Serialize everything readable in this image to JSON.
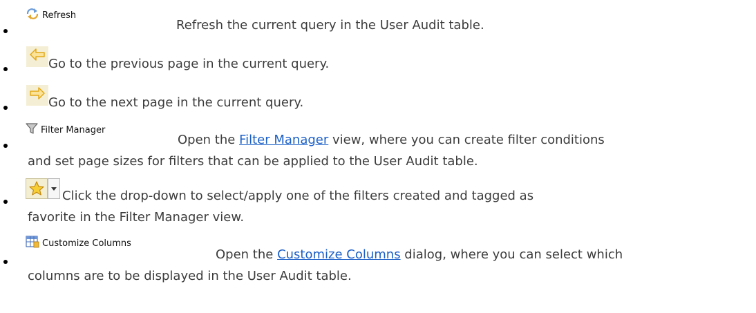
{
  "items": [
    {
      "button_label": "Refresh",
      "icon": "refresh-icon",
      "description": "Refresh the current query in the User Audit table."
    },
    {
      "icon": "previous-page-arrow-icon",
      "description": "Go to the previous page in the current query."
    },
    {
      "icon": "next-page-arrow-icon",
      "description": "Go to the next page in the current query."
    },
    {
      "button_label": "Filter Manager",
      "icon": "filter-funnel-icon",
      "text_before": "Open the ",
      "link": "Filter Manager",
      "text_after": " view, where you can create filter conditions",
      "continuation": "and set page sizes for filters that can be applied to the User Audit table."
    },
    {
      "icon": "favorite-star-icon",
      "dropdown_icon": "dropdown-arrow-icon",
      "description": "Click the drop-down to select/apply one of the filters created and tagged as",
      "continuation": "favorite in the Filter Manager view."
    },
    {
      "button_label": "Customize Columns",
      "icon": "customize-columns-icon",
      "text_before": "Open the ",
      "link": "Customize Columns",
      "text_after": " dialog, where you can select which",
      "continuation": "columns are to be displayed in the User Audit table."
    }
  ],
  "colors": {
    "text": "#3c3c3c",
    "link": "#1a5fc8",
    "arrow": "#f2c331",
    "star": "#f5c518"
  }
}
